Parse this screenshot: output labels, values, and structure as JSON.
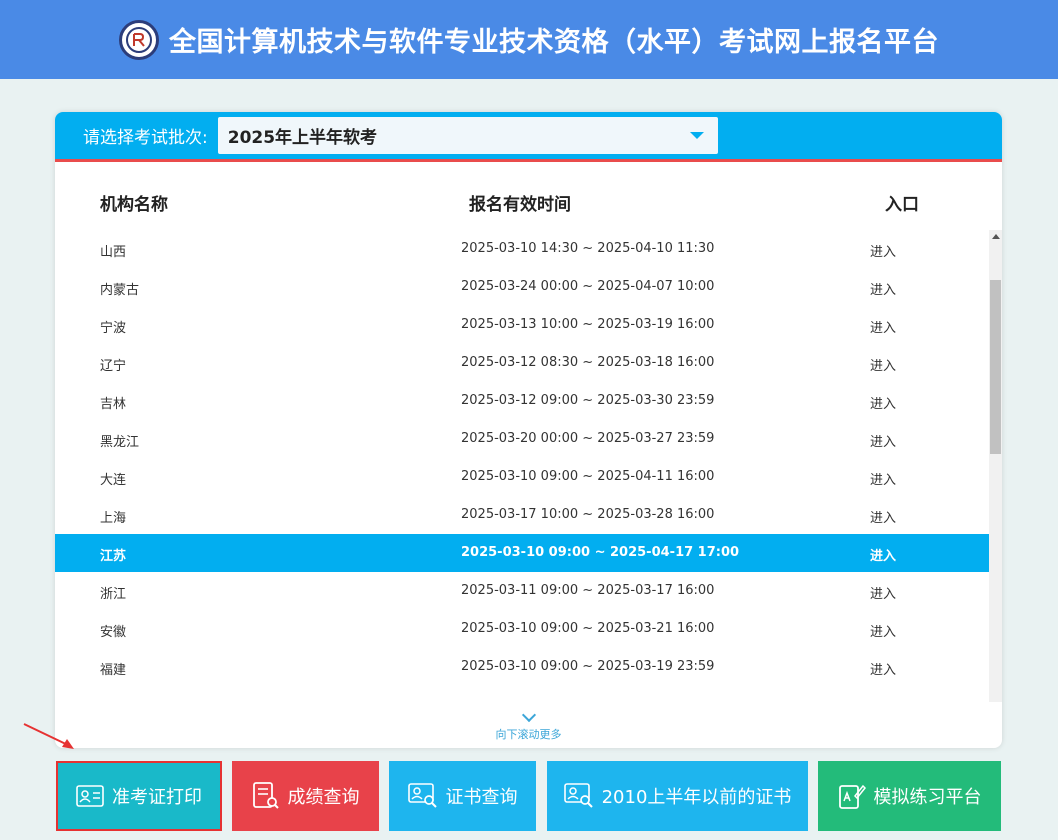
{
  "header": {
    "title": "全国计算机技术与软件专业技术资格（水平）考试网上报名平台"
  },
  "batch": {
    "label": "请选择考试批次:",
    "selected": "2025年上半年软考"
  },
  "table": {
    "headers": [
      "机构名称",
      "报名有效时间",
      "入口"
    ],
    "rows": [
      {
        "name": "山西",
        "time": "2025-03-10 14:30 ~ 2025-04-10 11:30",
        "entry": "进入"
      },
      {
        "name": "内蒙古",
        "time": "2025-03-24 00:00 ~ 2025-04-07 10:00",
        "entry": "进入"
      },
      {
        "name": "宁波",
        "time": "2025-03-13 10:00 ~ 2025-03-19 16:00",
        "entry": "进入"
      },
      {
        "name": "辽宁",
        "time": "2025-03-12 08:30 ~ 2025-03-18 16:00",
        "entry": "进入"
      },
      {
        "name": "吉林",
        "time": "2025-03-12 09:00 ~ 2025-03-30 23:59",
        "entry": "进入"
      },
      {
        "name": "黑龙江",
        "time": "2025-03-20 00:00 ~ 2025-03-27 23:59",
        "entry": "进入"
      },
      {
        "name": "大连",
        "time": "2025-03-10 09:00 ~ 2025-04-11 16:00",
        "entry": "进入"
      },
      {
        "name": "上海",
        "time": "2025-03-17 10:00 ~ 2025-03-28 16:00",
        "entry": "进入"
      },
      {
        "name": "江苏",
        "time": "2025-03-10 09:00 ~ 2025-04-17 17:00",
        "entry": "进入"
      },
      {
        "name": "浙江",
        "time": "2025-03-11 09:00 ~ 2025-03-17 16:00",
        "entry": "进入"
      },
      {
        "name": "安徽",
        "time": "2025-03-10 09:00 ~ 2025-03-21 16:00",
        "entry": "进入"
      },
      {
        "name": "福建",
        "time": "2025-03-10 09:00 ~ 2025-03-19 23:59",
        "entry": "进入"
      }
    ],
    "highlighted_row": "江苏",
    "scroll_more": "向下滚动更多"
  },
  "buttons": {
    "admission_ticket": "准考证打印",
    "score_query": "成绩查询",
    "certificate_query": "证书查询",
    "old_certificate": "2010上半年以前的证书",
    "practice": "模拟练习平台"
  },
  "colors": {
    "header_bg": "#4a8ae6",
    "panel_accent": "#02aef0",
    "highlight_row": "#02aef0",
    "btn_teal": "#19b9c9",
    "btn_red": "#e8424a",
    "btn_blue": "#1eb5ee",
    "btn_green": "#23bb7a",
    "annotation_red": "#e63232"
  }
}
